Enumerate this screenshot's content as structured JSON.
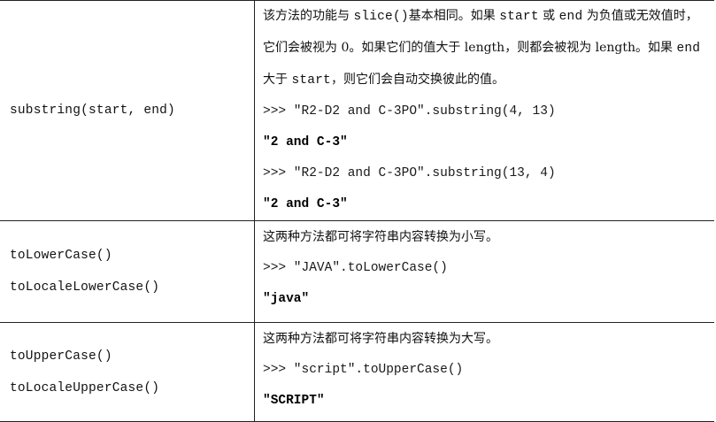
{
  "rows": [
    {
      "methods": [
        "substring(start, end)"
      ],
      "description": [
        {
          "t": "text",
          "v": "该方法的功能与 "
        },
        {
          "t": "code",
          "v": "slice()"
        },
        {
          "t": "text",
          "v": "基本相同。如果 "
        },
        {
          "t": "code",
          "v": "start"
        },
        {
          "t": "text",
          "v": " 或 "
        },
        {
          "t": "code",
          "v": "end"
        },
        {
          "t": "text",
          "v": " 为负值或无效值时，它们会被视为 0。如果它们的值大于 length，则都会被视为 length。如果 "
        },
        {
          "t": "code",
          "v": "end"
        },
        {
          "t": "text",
          "v": " 大于 "
        },
        {
          "t": "code",
          "v": "start"
        },
        {
          "t": "text",
          "v": "，则它们会自动交换彼此的值。"
        }
      ],
      "examples": [
        {
          "code": ">>> \"R2-D2 and C-3PO\".substring(4, 13)",
          "result": "\"2 and C-3\""
        },
        {
          "code": ">>> \"R2-D2 and C-3PO\".substring(13, 4)",
          "result": "\"2 and C-3\""
        }
      ]
    },
    {
      "methods": [
        "toLowerCase()",
        "toLocaleLowerCase()"
      ],
      "description": [
        {
          "t": "text",
          "v": "这两种方法都可将字符串内容转换为小写。"
        }
      ],
      "examples": [
        {
          "code": ">>> \"JAVA\".toLowerCase()",
          "result": "\"java\""
        }
      ]
    },
    {
      "methods": [
        "toUpperCase()",
        "toLocaleUpperCase()"
      ],
      "description": [
        {
          "t": "text",
          "v": "这两种方法都可将字符串内容转换为大写。"
        }
      ],
      "examples": [
        {
          "code": ">>> \"script\".toUpperCase()",
          "result": "\"SCRIPT\""
        }
      ]
    }
  ]
}
